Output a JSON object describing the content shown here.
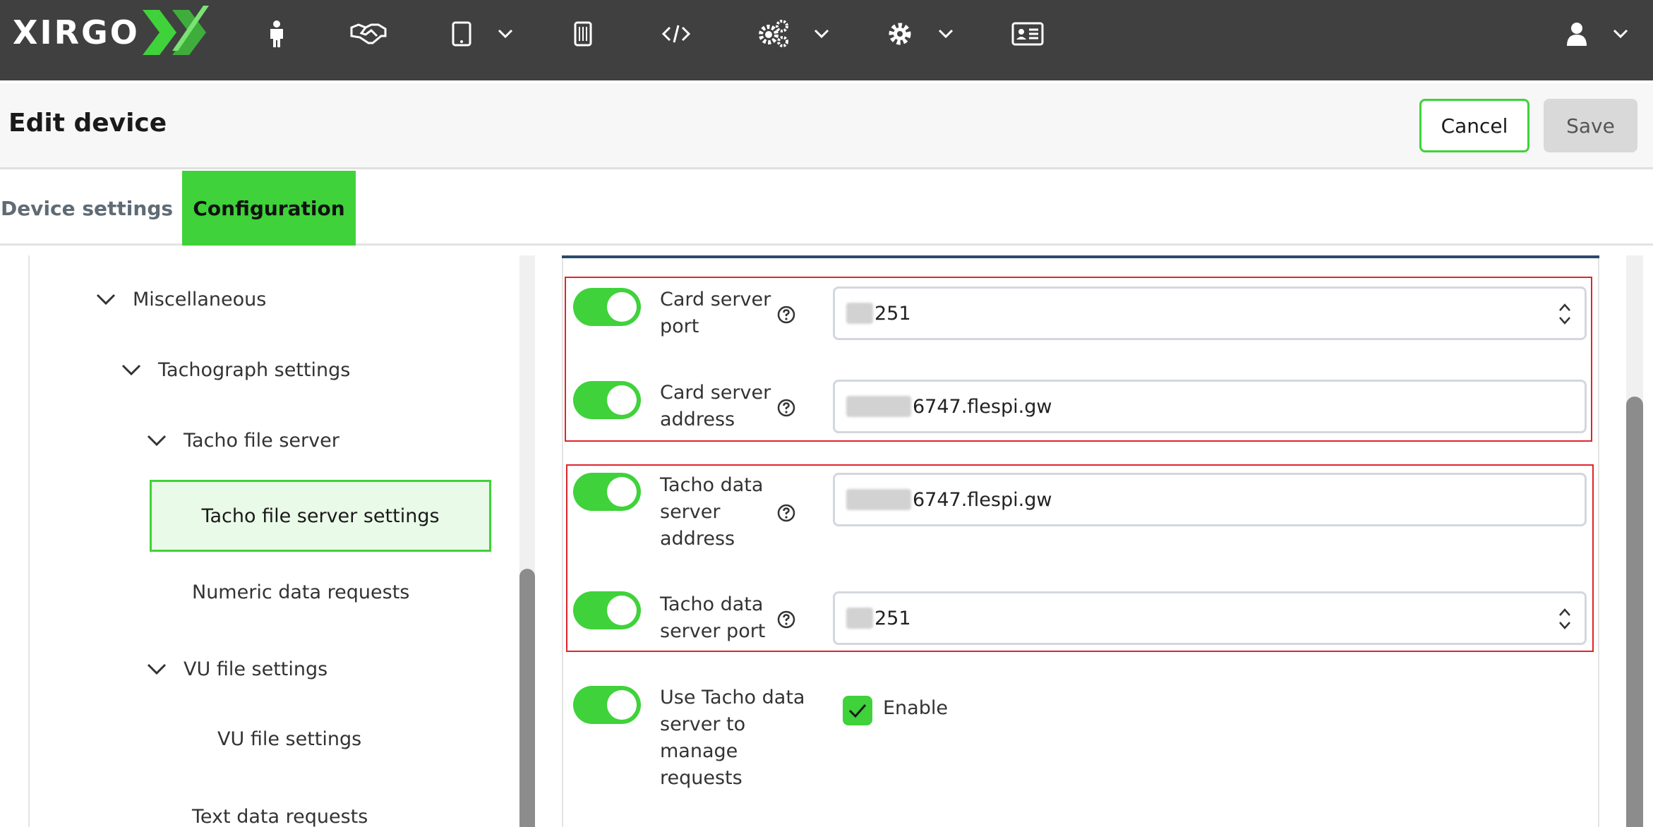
{
  "brand": {
    "logo_text": "XIRGO",
    "logo_mark": "X"
  },
  "colors": {
    "accent": "#3fd23a",
    "topbar": "#404040",
    "highlight_border": "#e0242b"
  },
  "nav": {
    "icons": [
      "person-icon",
      "handshake-icon",
      "tablet-icon",
      "sim-card-icon",
      "code-icon",
      "cogs-icon",
      "gear-icon",
      "id-card-icon",
      "user-icon"
    ]
  },
  "header": {
    "title": "Edit device",
    "cancel_label": "Cancel",
    "save_label": "Save"
  },
  "tabs": [
    {
      "label": "Device settings",
      "active": false
    },
    {
      "label": "Configuration",
      "active": true
    }
  ],
  "tree": {
    "items": [
      {
        "label": "Miscellaneous",
        "expanded": true
      },
      {
        "label": "Tachograph settings",
        "expanded": true
      },
      {
        "label": "Tacho file server",
        "expanded": true
      },
      {
        "label": "Tacho file server settings",
        "selected": true
      },
      {
        "label": "Numeric data requests"
      },
      {
        "label": "VU file settings",
        "expanded": true
      },
      {
        "label": "VU file settings"
      },
      {
        "label": "Text data requests"
      }
    ]
  },
  "settings": {
    "card_server_port": {
      "label": "Card server port",
      "value": "251",
      "enabled": true
    },
    "card_server_address": {
      "label": "Card server address",
      "value": "6747.flespi.gw",
      "enabled": true
    },
    "tacho_data_server_address": {
      "label": "Tacho data server address",
      "value": "6747.flespi.gw",
      "enabled": true
    },
    "tacho_data_server_port": {
      "label": "Tacho data server port",
      "value": "251",
      "enabled": true
    },
    "use_tacho_data_server": {
      "label": "Use Tacho data server to manage requests",
      "checkbox_label": "Enable",
      "checked": true,
      "enabled": true
    }
  }
}
